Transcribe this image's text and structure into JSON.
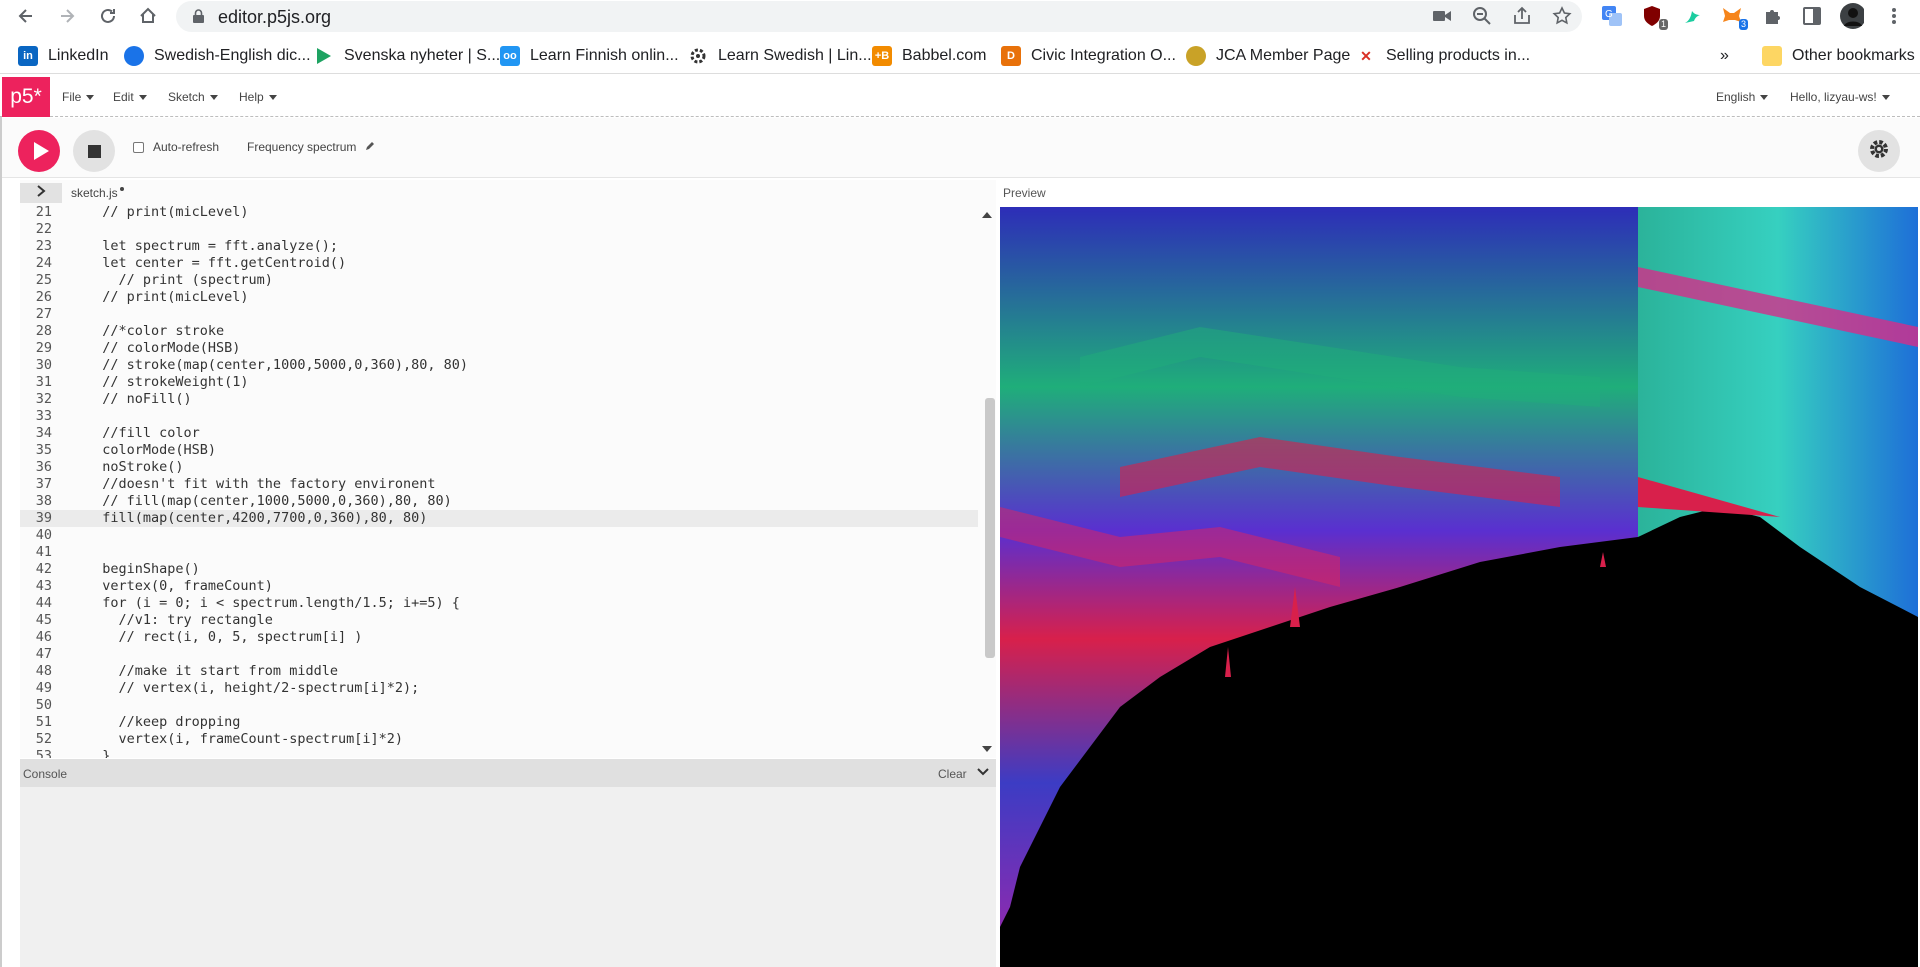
{
  "browser": {
    "url": "editor.p5js.org",
    "extensions": [
      {
        "icon": "camera-icon"
      },
      {
        "icon": "zoom-icon"
      },
      {
        "icon": "share-icon"
      },
      {
        "icon": "star-icon"
      },
      {
        "icon": "translate-icon"
      },
      {
        "icon": "ublock-icon",
        "badge": "1"
      },
      {
        "icon": "hummingbird-icon"
      },
      {
        "icon": "metamask-icon",
        "badge": "3"
      },
      {
        "icon": "puzzle-icon"
      },
      {
        "icon": "sidepanel-icon"
      },
      {
        "icon": "profile-avatar"
      },
      {
        "icon": "kebab-menu-icon"
      }
    ]
  },
  "bookmarks": {
    "items": [
      {
        "label": "LinkedIn",
        "icon": "linkedin-icon",
        "color": "#0a66c2"
      },
      {
        "label": "Swedish-English dic...",
        "icon": "dictionary-icon",
        "color": "#1a73e8"
      },
      {
        "label": "Svenska nyheter | S...",
        "icon": "play-triangle-icon",
        "color": "#1ea362"
      },
      {
        "label": "Learn Finnish onlin...",
        "icon": "learn-finnish-icon",
        "color": "#2196f3"
      },
      {
        "label": "Learn Swedish | Lin...",
        "icon": "gear-logo-icon",
        "color": "#333333"
      },
      {
        "label": "Babbel.com",
        "icon": "babbel-icon",
        "color": "#f28b00"
      },
      {
        "label": "Civic Integration O...",
        "icon": "civic-icon",
        "color": "#e8710a"
      },
      {
        "label": "JCA Member Page",
        "icon": "jca-icon",
        "color": "#c9a227"
      },
      {
        "label": "Selling products in...",
        "icon": "amsterdam-icon",
        "color": "#d93025"
      }
    ],
    "overflow": "»",
    "other": "Other bookmarks"
  },
  "p5": {
    "logo": "p5*",
    "menus": [
      "File",
      "Edit",
      "Sketch",
      "Help"
    ],
    "language": "English",
    "user": "Hello, lizyau-ws!",
    "autorefresh": "Auto-refresh",
    "sketch_name": "Frequency spectrum",
    "file_tab": "sketch.js",
    "preview_label": "Preview",
    "console_label": "Console",
    "console_clear": "Clear",
    "accent": "#ed225d"
  },
  "code": {
    "active_line": 39,
    "lines": [
      {
        "n": "21",
        "text": "  // print(micLevel)"
      },
      {
        "n": "22",
        "text": ""
      },
      {
        "n": "23",
        "text": "  let spectrum = fft.analyze();"
      },
      {
        "n": "24",
        "text": "  let center = fft.getCentroid()"
      },
      {
        "n": "25",
        "text": "    // print (spectrum)"
      },
      {
        "n": "26",
        "text": "  // print(micLevel)"
      },
      {
        "n": "27",
        "text": ""
      },
      {
        "n": "28",
        "text": "  //*color stroke"
      },
      {
        "n": "29",
        "text": "  // colorMode(HSB)"
      },
      {
        "n": "30",
        "text": "  // stroke(map(center,1000,5000,0,360),80, 80)"
      },
      {
        "n": "31",
        "text": "  // strokeWeight(1)"
      },
      {
        "n": "32",
        "text": "  // noFill()"
      },
      {
        "n": "33",
        "text": ""
      },
      {
        "n": "34",
        "text": "  //fill color"
      },
      {
        "n": "35",
        "text": "  colorMode(HSB)"
      },
      {
        "n": "36",
        "text": "  noStroke()"
      },
      {
        "n": "37",
        "text": "  //doesn't fit with the factory environent"
      },
      {
        "n": "38",
        "text": "  // fill(map(center,1000,5000,0,360),80, 80)"
      },
      {
        "n": "39",
        "text": "  fill(map(center,4200,7700,0,360),80, 80)"
      },
      {
        "n": "40",
        "text": ""
      },
      {
        "n": "41",
        "text": ""
      },
      {
        "n": "42",
        "text": "  beginShape()"
      },
      {
        "n": "43",
        "text": "  vertex(0, frameCount)"
      },
      {
        "n": "44",
        "text": "  for (i = 0; i < spectrum.length/1.5; i+=5) {"
      },
      {
        "n": "45",
        "text": "    //v1: try rectangle"
      },
      {
        "n": "46",
        "text": "    // rect(i, 0, 5, spectrum[i] )"
      },
      {
        "n": "47",
        "text": ""
      },
      {
        "n": "48",
        "text": "    //make it start from middle"
      },
      {
        "n": "49",
        "text": "    // vertex(i, height/2-spectrum[i]*2);"
      },
      {
        "n": "50",
        "text": ""
      },
      {
        "n": "51",
        "text": "    //keep dropping"
      },
      {
        "n": "52",
        "text": "    vertex(i, frameCount-spectrum[i]*2)"
      },
      {
        "n": "53",
        "text": "  }"
      }
    ]
  }
}
